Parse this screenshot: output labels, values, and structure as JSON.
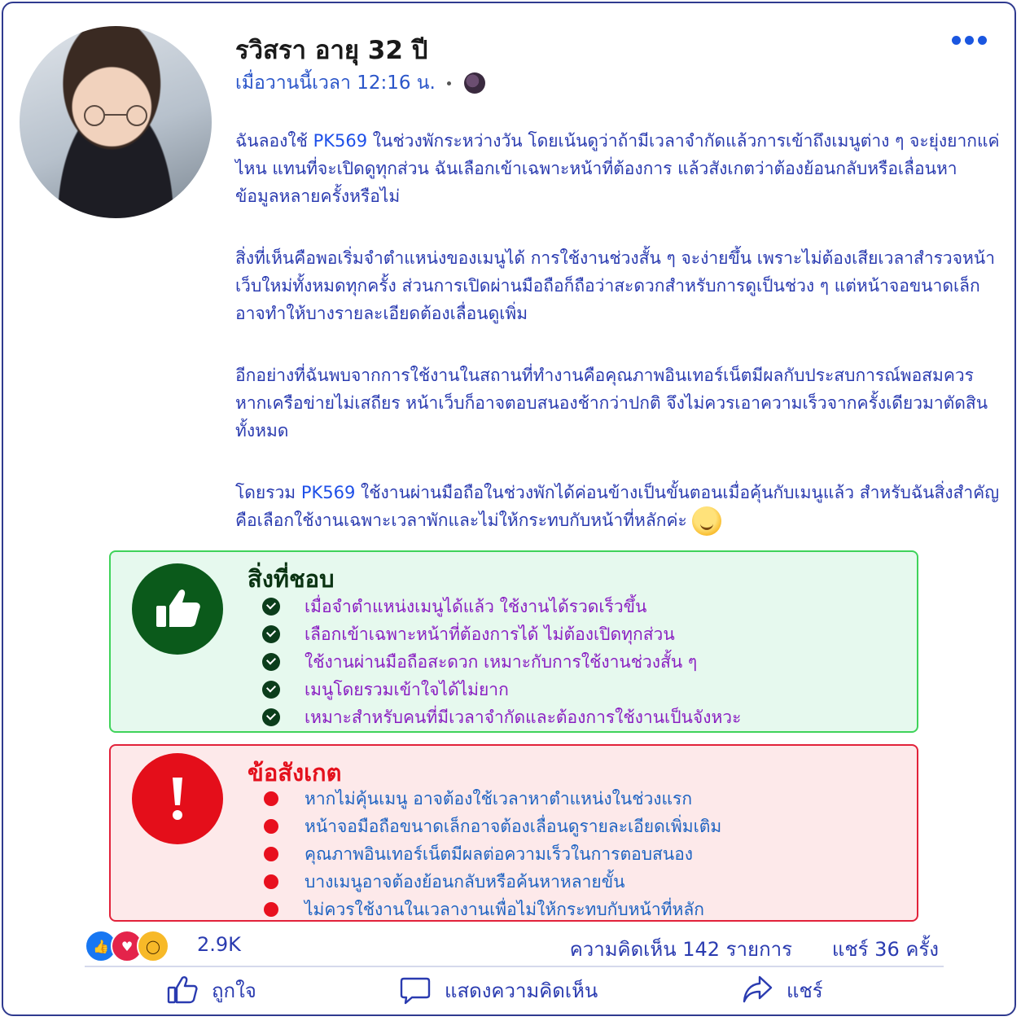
{
  "post": {
    "author_name": "รวิสรา อายุ 32 ปี",
    "timestamp": "เมื่อวานนี้เวลา 12:16 น.",
    "privacy_icon": "globe-icon",
    "paragraphs": [
      {
        "before": "ฉันลองใช้ ",
        "brand": "PK569",
        "after": " ในช่วงพักระหว่างวัน โดยเน้นดูว่าถ้ามีเวลาจำกัดแล้วการเข้าถึงเมนูต่าง ๆ จะยุ่งยากแค่ไหน แทนที่จะเปิดดูทุกส่วน ฉันเลือกเข้าเฉพาะหน้าที่ต้องการ แล้วสังเกตว่าต้องย้อนกลับหรือเลื่อนหาข้อมูลหลายครั้งหรือไม่"
      },
      {
        "before": "สิ่งที่เห็นคือพอเริ่มจำตำแหน่งของเมนูได้ การใช้งานช่วงสั้น ๆ จะง่ายขึ้น เพราะไม่ต้องเสียเวลาสำรวจหน้าเว็บใหม่ทั้งหมดทุกครั้ง ส่วนการเปิดผ่านมือถือก็ถือว่าสะดวกสำหรับการดูเป็นช่วง ๆ แต่หน้าจอขนาดเล็กอาจทำให้บางรายละเอียดต้องเลื่อนดูเพิ่ม",
        "brand": "",
        "after": ""
      },
      {
        "before": "อีกอย่างที่ฉันพบจากการใช้งานในสถานที่ทำงานคือคุณภาพอินเทอร์เน็ตมีผลกับประสบการณ์พอสมควร หากเครือข่ายไม่เสถียร หน้าเว็บก็อาจตอบสนองช้ากว่าปกติ จึงไม่ควรเอาความเร็วจากครั้งเดียวมาตัดสินทั้งหมด",
        "brand": "",
        "after": ""
      },
      {
        "before": "โดยรวม ",
        "brand": "PK569",
        "after": " ใช้งานผ่านมือถือในช่วงพักได้ค่อนข้างเป็นขั้นตอนเมื่อคุ้นกับเมนูแล้ว สำหรับฉันสิ่งสำคัญคือเลือกใช้งานเฉพาะเวลาพักและไม่ให้กระทบกับหน้าที่หลักค่ะ"
      }
    ]
  },
  "likes": {
    "title": "สิ่งที่ชอบ",
    "icon": "thumbs-up-icon",
    "items": [
      "เมื่อจำตำแหน่งเมนูได้แล้ว ใช้งานได้รวดเร็วขึ้น",
      "เลือกเข้าเฉพาะหน้าที่ต้องการได้ ไม่ต้องเปิดทุกส่วน",
      "ใช้งานผ่านมือถือสะดวก เหมาะกับการใช้งานช่วงสั้น ๆ",
      "เมนูโดยรวมเข้าใจได้ไม่ยาก",
      "เหมาะสำหรับคนที่มีเวลาจำกัดและต้องการใช้งานเป็นจังหวะ"
    ]
  },
  "notes": {
    "title": "ข้อสังเกต",
    "icon": "exclamation-icon",
    "items": [
      "หากไม่คุ้นเมนู อาจต้องใช้เวลาหาตำแหน่งในช่วงแรก",
      "หน้าจอมือถือขนาดเล็กอาจต้องเลื่อนดูรายละเอียดเพิ่มเติม",
      "คุณภาพอินเทอร์เน็ตมีผลต่อความเร็วในการตอบสนอง",
      "บางเมนูอาจต้องย้อนกลับหรือค้นหาหลายขั้น",
      "ไม่ควรใช้งานในเวลางานเพื่อไม่ให้กระทบกับหน้าที่หลัก"
    ]
  },
  "stats": {
    "reaction_count": "2.9K",
    "comments": "ความคิดเห็น 142 รายการ",
    "shares": "แชร์   36 ครั้ง"
  },
  "actions": {
    "like": "ถูกใจ",
    "comment": "แสดงความคิดเห็น",
    "share": "แชร์"
  },
  "colors": {
    "primary_text": "#2a3bb0",
    "brand": "#1d4fe8",
    "likes_bg": "#e6f9ee",
    "likes_border": "#3fd35a",
    "notes_bg": "#fde9ea",
    "notes_border": "#e2223a"
  }
}
